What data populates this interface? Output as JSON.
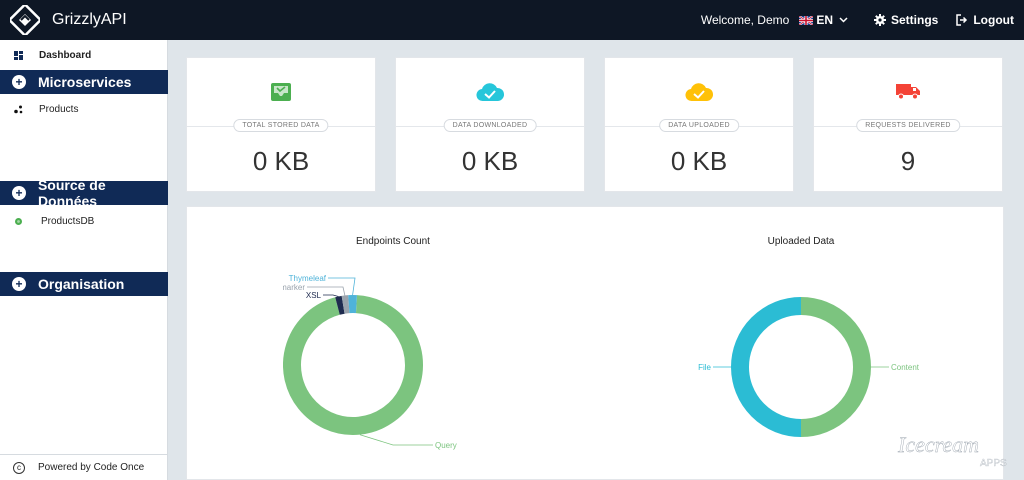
{
  "header": {
    "app_name": "GrizzlyAPI",
    "welcome": "Welcome, Demo",
    "language": "EN",
    "settings_label": "Settings",
    "logout_label": "Logout"
  },
  "sidebar": {
    "dashboard_label": "Dashboard",
    "sections": [
      {
        "title": "Microservices",
        "items": [
          "Products"
        ]
      },
      {
        "title": "Source de Données",
        "items": [
          "ProductsDB"
        ]
      },
      {
        "title": "Organisation",
        "items": []
      }
    ],
    "footer": "Powered by Code Once"
  },
  "stats": [
    {
      "label": "TOTAL STORED DATA",
      "value": "0 KB",
      "icon": "inbox-icon",
      "color": "#4caf50"
    },
    {
      "label": "DATA DOWNLOADED",
      "value": "0 KB",
      "icon": "cloud-check-icon",
      "color": "#26c6da"
    },
    {
      "label": "DATA UPLOADED",
      "value": "0 KB",
      "icon": "cloud-check-icon",
      "color": "#ffc107"
    },
    {
      "label": "REQUESTS DELIVERED",
      "value": "9",
      "icon": "truck-icon",
      "color": "#f44336"
    }
  ],
  "chart_data": [
    {
      "type": "pie",
      "title": "Endpoints Count",
      "categories": [
        "Query",
        "XSL",
        "Freemarker",
        "Thymeleaf"
      ],
      "values": [
        95,
        1.5,
        1.5,
        2
      ],
      "colors": [
        "#7cc47f",
        "#1f2b4f",
        "#9aa3ad",
        "#4fb3d9"
      ]
    },
    {
      "type": "pie",
      "title": "Uploaded Data",
      "categories": [
        "Content",
        "File"
      ],
      "values": [
        50,
        50
      ],
      "colors": [
        "#7cc47f",
        "#2bbcd4"
      ]
    }
  ],
  "watermark": {
    "brand": "Icecream",
    "sub": "APPS"
  },
  "colors": {
    "topbar": "#0e1725",
    "sidebar_section": "#102a56"
  }
}
